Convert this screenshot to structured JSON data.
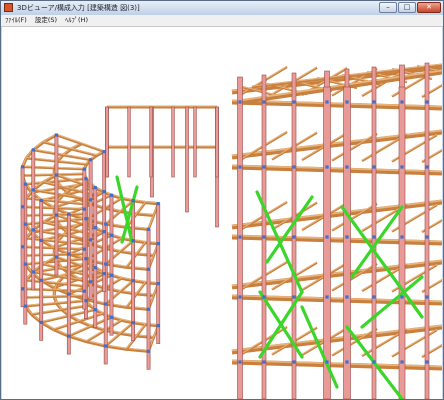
{
  "window": {
    "title": "3Dビューア/構成入力 [建築構造 図(3)]",
    "minimize_glyph": "–",
    "maximize_glyph": "□",
    "close_glyph": "✕"
  },
  "menu": {
    "items": [
      {
        "label": "ﾌｧｲﾙ(F)"
      },
      {
        "label": "設定(S)"
      },
      {
        "label": "ﾍﾙﾌﾟ(H)"
      }
    ]
  },
  "viewport": {
    "content": "3D steel frame structure (curved and rectangular sections)",
    "colors": {
      "background": "#ffffff",
      "column": "#e79a96",
      "column_edge": "#9c4a46",
      "beam": "#c9803e",
      "beam_top": "#e7b47c",
      "brace": "#3bd62a",
      "joint": "#3f6fd0"
    }
  }
}
